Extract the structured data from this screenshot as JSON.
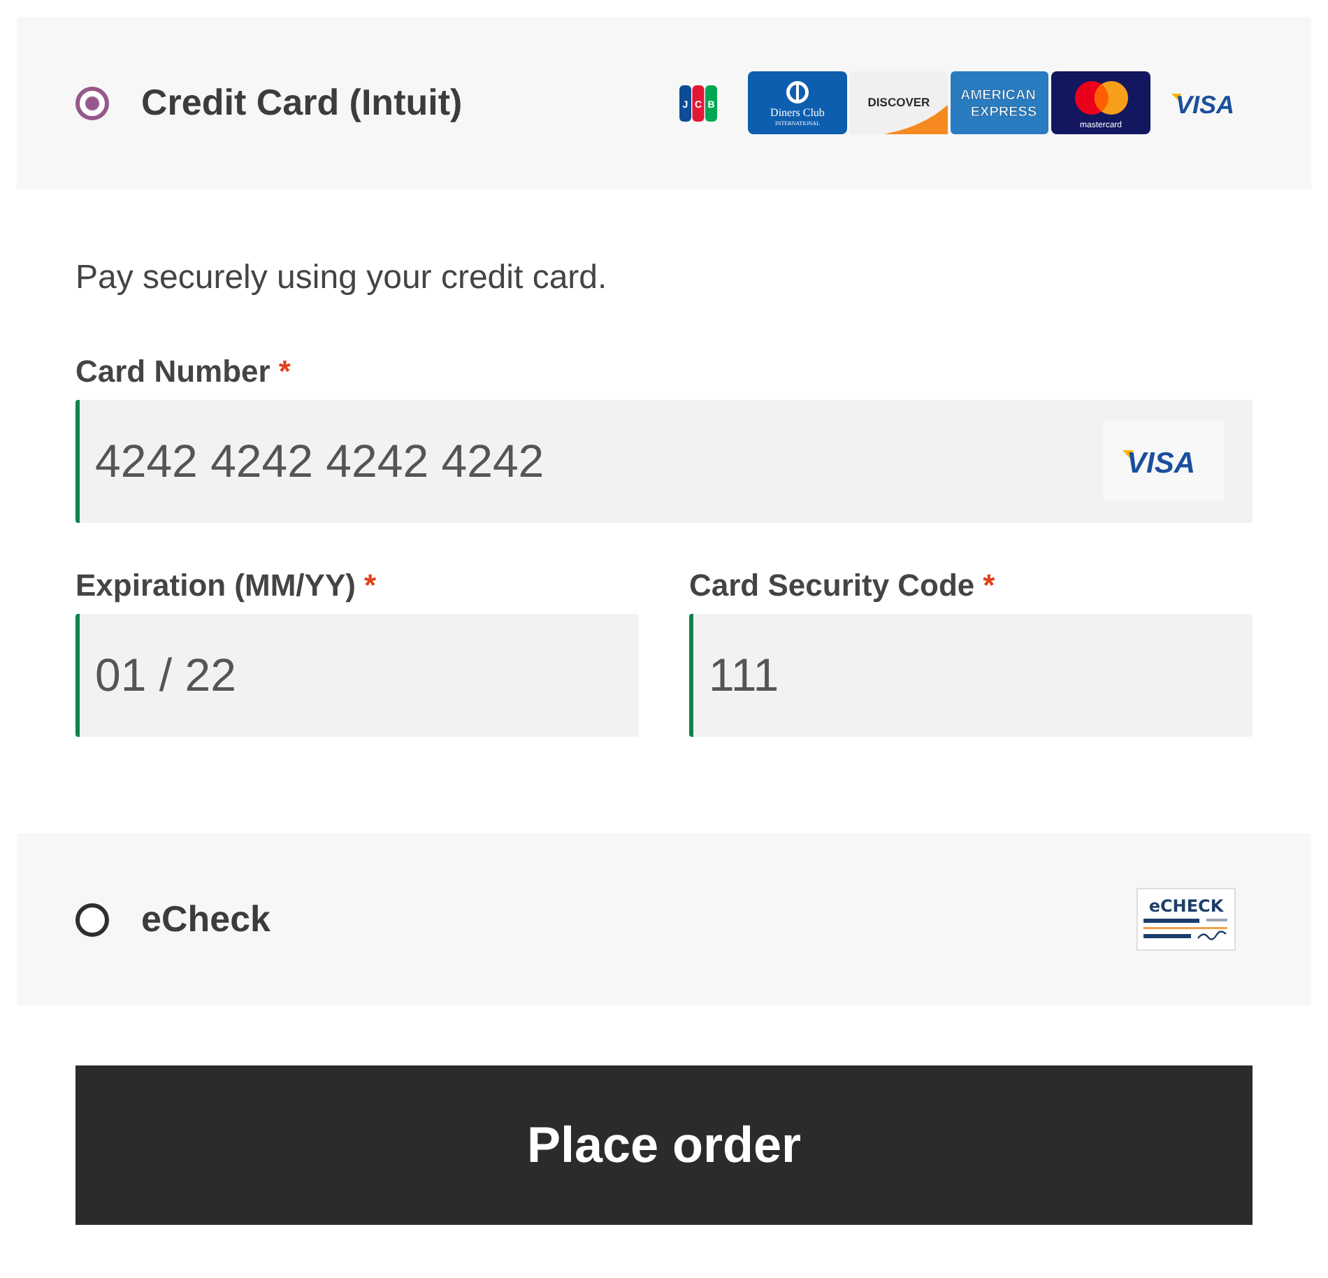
{
  "payment_methods": [
    {
      "label": "Credit Card (Intuit)",
      "selected": true,
      "logos": [
        {
          "kind": "jcb",
          "text": [
            "J",
            "C",
            "B"
          ]
        },
        {
          "kind": "diners_club",
          "text": [
            "Diners Club",
            "INTERNATIONAL"
          ]
        },
        {
          "kind": "discover",
          "text": [
            "DISCOVER"
          ]
        },
        {
          "kind": "amex",
          "text": [
            "AMERICAN",
            "EXPRESS"
          ]
        },
        {
          "kind": "mastercard",
          "text": [
            "mastercard"
          ]
        },
        {
          "kind": "visa",
          "text": [
            "VISA"
          ]
        }
      ],
      "description": "Pay securely using your credit card.",
      "fields": [
        {
          "kind": "card_number",
          "label": "Card Number",
          "mark": "*",
          "value": "4242 4242 4242 4242",
          "valid": true,
          "logo": {
            "kind": "visa_tile",
            "text": [
              "VISA"
            ]
          }
        },
        {
          "kind": "expiry",
          "label": "Expiration (MM/YY)",
          "mark": "*",
          "value": "01 / 22",
          "valid": true
        },
        {
          "kind": "security_code",
          "label": "Card Security Code",
          "mark": "*",
          "value": "111",
          "valid": true
        }
      ]
    },
    {
      "label": "eCheck",
      "selected": false,
      "logos": [
        {
          "kind": "echeck",
          "text": [
            "eCHECK"
          ]
        }
      ]
    }
  ],
  "button": {
    "label": "Place order"
  }
}
